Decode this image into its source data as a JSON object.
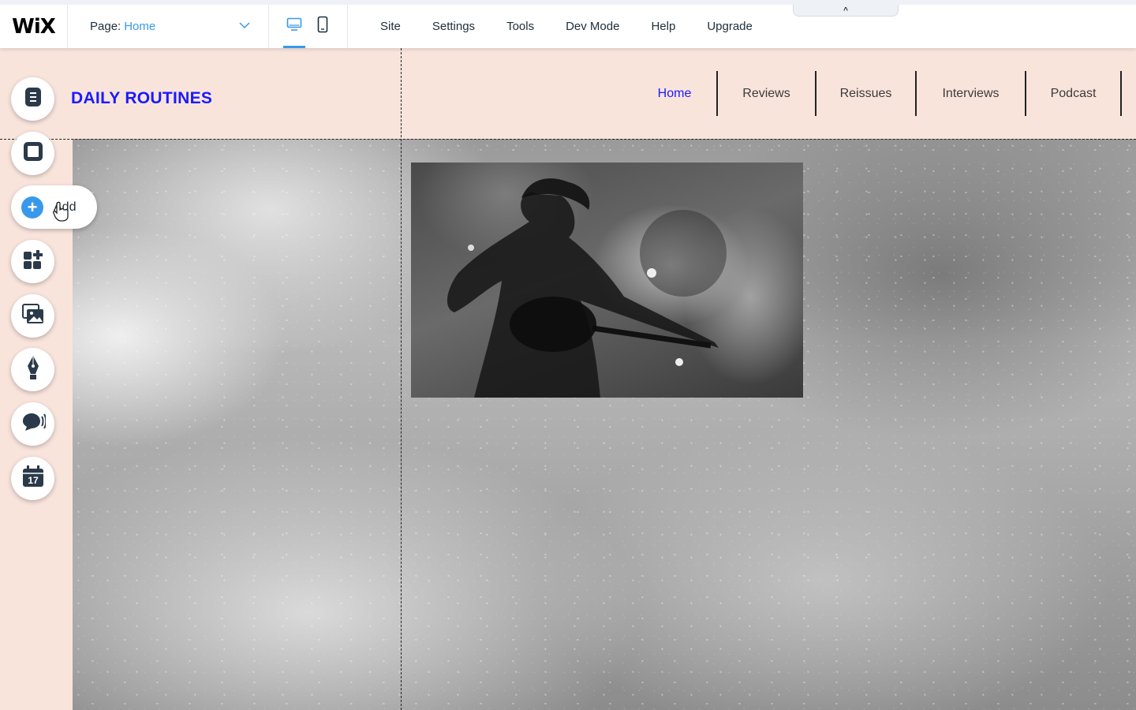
{
  "editor": {
    "logo": "WiX",
    "page_selector": {
      "label": "Page:",
      "value": "Home"
    },
    "menu": [
      "Site",
      "Settings",
      "Tools",
      "Dev Mode",
      "Help",
      "Upgrade"
    ],
    "collapse_symbol": "^",
    "colors": {
      "accent": "#3899ec",
      "canvas_bg": "#f9e4dc",
      "site_link": "#1a1aff"
    }
  },
  "tools": {
    "add_label": "Add",
    "icons": [
      "pages-icon",
      "background-icon",
      "add-icon",
      "add-apps-icon",
      "media-icon",
      "blog-pen-icon",
      "chat-icon",
      "bookings-calendar-icon"
    ],
    "calendar_day": "17"
  },
  "site": {
    "title": "DAILY ROUTINES",
    "nav": [
      "Home",
      "Reviews",
      "Reissues",
      "Interviews",
      "Podcast"
    ],
    "active_nav": "Home"
  }
}
